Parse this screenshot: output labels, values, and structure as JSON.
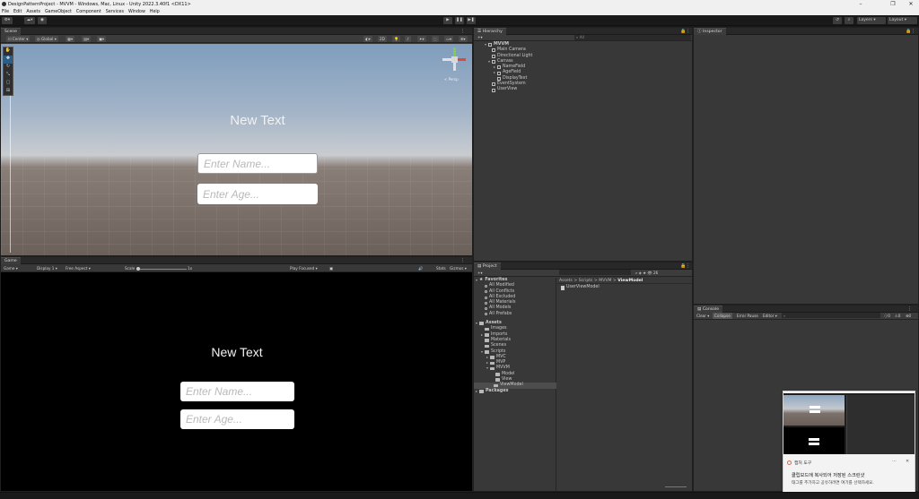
{
  "window": {
    "title": "DesignPatternProject - MVVM - Windows, Mac, Linux - Unity 2022.3.40f1 <DX11>"
  },
  "menu": [
    "File",
    "Edit",
    "Assets",
    "GameObject",
    "Component",
    "Services",
    "Window",
    "Help"
  ],
  "toolbar": {
    "layers_label": "Layers",
    "layout_label": "Layout"
  },
  "scene": {
    "tab": "Scene",
    "pivot_label": "Center",
    "global_label": "Global",
    "mode_2d": "2D",
    "axis_label": "< Persp",
    "canvas_text": "New Text",
    "name_placeholder": "Enter Name...",
    "age_placeholder": "Enter Age..."
  },
  "game": {
    "tab": "Game",
    "view_label": "Game",
    "display_label": "Display 1",
    "aspect_label": "Free Aspect",
    "scale_label": "Scale",
    "scale_value": "1x",
    "play_focused": "Play Focused",
    "stats_label": "Stats",
    "gizmos_label": "Gizmos",
    "canvas_text": "New Text",
    "name_placeholder": "Enter Name...",
    "age_placeholder": "Enter Age..."
  },
  "hierarchy": {
    "tab": "Hierarchy",
    "search_placeholder": "All",
    "items": [
      {
        "label": "MVVM",
        "depth": 0
      },
      {
        "label": "Main Camera",
        "depth": 1
      },
      {
        "label": "Directional Light",
        "depth": 1
      },
      {
        "label": "Canvas",
        "depth": 1
      },
      {
        "label": "NameField",
        "depth": 2
      },
      {
        "label": "AgeField",
        "depth": 2
      },
      {
        "label": "DisplayText",
        "depth": 2
      },
      {
        "label": "EventSystem",
        "depth": 1
      },
      {
        "label": "UserView",
        "depth": 1
      }
    ]
  },
  "inspector": {
    "tab": "Inspector"
  },
  "project": {
    "tab": "Project",
    "favorites_label": "Favorites",
    "favorites": [
      "All Modified",
      "All Conflicts",
      "All Excluded",
      "All Materials",
      "All Models",
      "All Prefabs"
    ],
    "assets_label": "Assets",
    "assets": [
      {
        "label": "Images",
        "depth": 1
      },
      {
        "label": "Imports",
        "depth": 1
      },
      {
        "label": "Materials",
        "depth": 1
      },
      {
        "label": "Scenes",
        "depth": 1
      },
      {
        "label": "Scripts",
        "depth": 1
      },
      {
        "label": "MVC",
        "depth": 2
      },
      {
        "label": "MVP",
        "depth": 2
      },
      {
        "label": "MVVM",
        "depth": 2
      },
      {
        "label": "Model",
        "depth": 3
      },
      {
        "label": "View",
        "depth": 3
      },
      {
        "label": "ViewModel",
        "depth": 3
      }
    ],
    "packages_label": "Packages",
    "breadcrumb": [
      "Assets",
      "Scripts",
      "MVVM",
      "ViewModel"
    ],
    "files": [
      "UserViewModel"
    ],
    "hidden_count": "26"
  },
  "console": {
    "tab": "Console",
    "clear": "Clear",
    "collapse": "Collapse",
    "error_pause": "Error Pause",
    "editor": "Editor",
    "counts": [
      "0",
      "0",
      "0"
    ]
  },
  "notification": {
    "app": "캡처 도구",
    "title": "클립보드에 복사되어 저장된 스크린샷",
    "body": "태그를 추가하고 공유하려면 여기를 선택하세요."
  },
  "colors": {
    "accent": "#2c5d87",
    "selection": "#4d4d4d",
    "panel": "#383838"
  }
}
